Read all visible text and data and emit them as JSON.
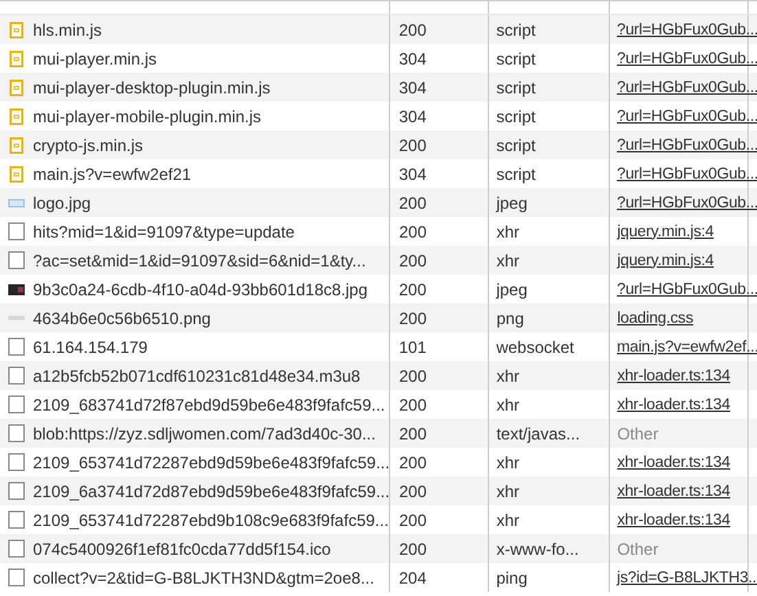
{
  "rows": [
    {
      "kind": "script-file",
      "name": "hls.min.js",
      "status": "200",
      "type": "script",
      "initiator": "?url=HGbFux0Gub...",
      "link": true
    },
    {
      "kind": "script-file",
      "name": "mui-player.min.js",
      "status": "304",
      "type": "script",
      "initiator": "?url=HGbFux0Gub...",
      "link": true
    },
    {
      "kind": "script-file",
      "name": "mui-player-desktop-plugin.min.js",
      "status": "304",
      "type": "script",
      "initiator": "?url=HGbFux0Gub...",
      "link": true
    },
    {
      "kind": "script-file",
      "name": "mui-player-mobile-plugin.min.js",
      "status": "304",
      "type": "script",
      "initiator": "?url=HGbFux0Gub...",
      "link": true
    },
    {
      "kind": "script-file",
      "name": "crypto-js.min.js",
      "status": "200",
      "type": "script",
      "initiator": "?url=HGbFux0Gub...",
      "link": true
    },
    {
      "kind": "script-file",
      "name": "main.js?v=ewfw2ef21",
      "status": "304",
      "type": "script",
      "initiator": "?url=HGbFux0Gub...",
      "link": true
    },
    {
      "kind": "image-file",
      "name": "logo.jpg",
      "status": "200",
      "type": "jpeg",
      "initiator": "?url=HGbFux0Gub...",
      "link": true
    },
    {
      "kind": "document",
      "name": "hits?mid=1&id=91097&type=update",
      "status": "200",
      "type": "xhr",
      "initiator": "jquery.min.js:4",
      "link": true
    },
    {
      "kind": "document",
      "name": "?ac=set&mid=1&id=91097&sid=6&nid=1&ty...",
      "status": "200",
      "type": "xhr",
      "initiator": "jquery.min.js:4",
      "link": true
    },
    {
      "kind": "thumbnail",
      "name": "9b3c0a24-6cdb-4f10-a04d-93bb601d18c8.jpg",
      "status": "200",
      "type": "jpeg",
      "initiator": "?url=HGbFux0Gub...",
      "link": true
    },
    {
      "kind": "png-file",
      "name": "4634b6e0c56b6510.png",
      "status": "200",
      "type": "png",
      "initiator": "loading.css",
      "link": true
    },
    {
      "kind": "document",
      "name": "61.164.154.179",
      "status": "101",
      "type": "websocket",
      "initiator": "main.js?v=ewfw2ef...",
      "link": true
    },
    {
      "kind": "document",
      "name": "a12b5fcb52b071cdf610231c81d48e34.m3u8",
      "status": "200",
      "type": "xhr",
      "initiator": "xhr-loader.ts:134",
      "link": true
    },
    {
      "kind": "document",
      "name": "2109_683741d72f87ebd9d59be6e483f9fafc59...",
      "status": "200",
      "type": "xhr",
      "initiator": "xhr-loader.ts:134",
      "link": true
    },
    {
      "kind": "document",
      "name": "blob:https://zyz.sdljwomen.com/7ad3d40c-30...",
      "status": "200",
      "type": "text/javas...",
      "initiator": "Other",
      "link": false
    },
    {
      "kind": "document",
      "name": "2109_653741d72287ebd9d59be6e483f9fafc59...",
      "status": "200",
      "type": "xhr",
      "initiator": "xhr-loader.ts:134",
      "link": true
    },
    {
      "kind": "document",
      "name": "2109_6a3741d72d87ebd9d59be6e483f9fafc59...",
      "status": "200",
      "type": "xhr",
      "initiator": "xhr-loader.ts:134",
      "link": true
    },
    {
      "kind": "document",
      "name": "2109_653741d72287ebd9b108c9e683f9fafc59...",
      "status": "200",
      "type": "xhr",
      "initiator": "xhr-loader.ts:134",
      "link": true
    },
    {
      "kind": "document",
      "name": "074c5400926f1ef81fc0cda77dd5f154.ico",
      "status": "200",
      "type": "x-www-fo...",
      "initiator": "Other",
      "link": false
    },
    {
      "kind": "document",
      "name": "collect?v=2&tid=G-B8LJKTH3ND&gtm=2oe8...",
      "status": "204",
      "type": "ping",
      "initiator": "js?id=G-B8LJKTH3...",
      "link": true
    }
  ]
}
